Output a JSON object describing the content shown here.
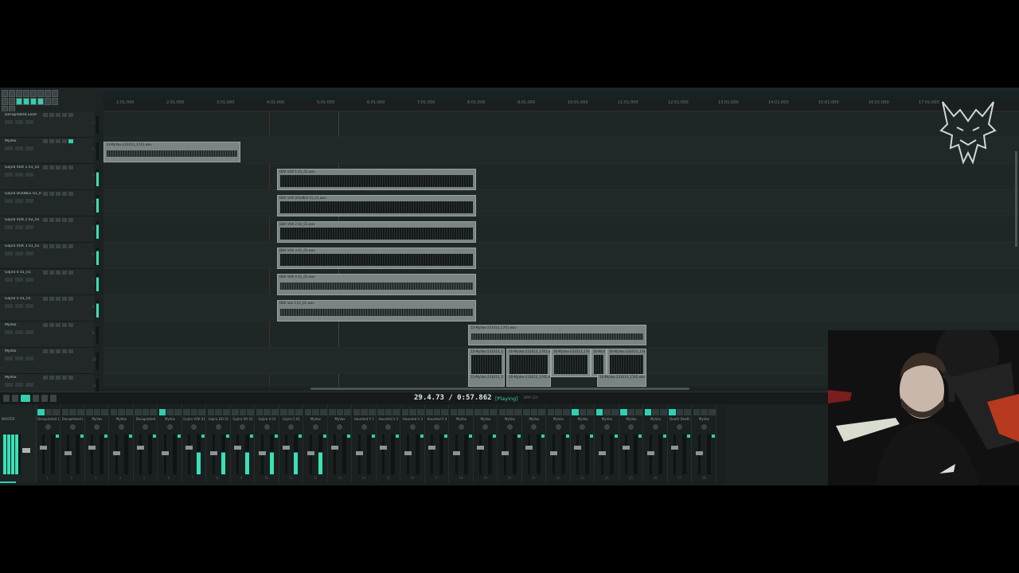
{
  "ruler": {
    "ticks": [
      "1:01:000",
      "2:01:000",
      "3:01:000",
      "4:01:000",
      "5:01:000",
      "6:01:000",
      "7:01:000",
      "8:01:000",
      "9:01:000",
      "10:01:000",
      "11:01:000",
      "12:01:000",
      "13:01:000",
      "14:01:000",
      "15:01:000",
      "16:01:000",
      "17:01:000"
    ]
  },
  "tracks": [
    {
      "name": "Decapitated Lead",
      "input": "Input 1",
      "num": "1"
    },
    {
      "name": "MyVox",
      "input": "Input 1",
      "num": "2"
    },
    {
      "name": "Gojira VOX 1 01_01",
      "input": "Input 1",
      "num": "3"
    },
    {
      "name": "Gojira DOUBLE 01_01",
      "input": "Input 1",
      "num": "4"
    },
    {
      "name": "Gojira VOX 2 02_01",
      "input": "Input 1",
      "num": "5"
    },
    {
      "name": "Gojira VOX 3 01_01",
      "input": "Input 1",
      "num": "6"
    },
    {
      "name": "Gojira 4 01_01",
      "input": "Input 1",
      "num": "7"
    },
    {
      "name": "Gojira 5 01_01",
      "input": "Input 1",
      "num": "8"
    },
    {
      "name": "MyVox",
      "input": "Input 1",
      "num": "9"
    },
    {
      "name": "MyVox",
      "input": "Input 1",
      "num": "10"
    },
    {
      "name": "MyVox",
      "input": "Input 1",
      "num": "11"
    }
  ],
  "clips": [
    {
      "name": "14-MyVox-231013_1741.wav"
    },
    {
      "name": "DBX VOX 1 01_01.wav"
    },
    {
      "name": "DBX VOX DOUBLE 01_01.wav"
    },
    {
      "name": "DBX VOX 2 02_01.wav"
    },
    {
      "name": "DBX VOX 3 01_01.wav"
    },
    {
      "name": "DBX VOX 4 01_01.wav"
    },
    {
      "name": "DBX Vox 5 01_01.wav"
    },
    {
      "name": "15-MyVox-231013_1741.wav"
    },
    {
      "name": "15-MyVox-231013_17"
    },
    {
      "name": "16-MyVox-231013_1741.wav"
    },
    {
      "name": "16-MyVox-231013_1741"
    },
    {
      "name": "16-MyV"
    },
    {
      "name": "16-MyVox-231013_1741"
    },
    {
      "name": "15-MyVox-231013_17"
    },
    {
      "name": "16-MyVox-231013_1745.wav"
    },
    {
      "name": "16-MyVox-231013_1745.wav"
    }
  ],
  "transport": {
    "time": "29.4.73 / 0:57.862",
    "status": "[Playing]",
    "bpm": "BPM 120",
    "sig": "4/4"
  },
  "mixer": {
    "master": "MASTER",
    "strips": [
      {
        "name": "Decapitated L",
        "num": "1"
      },
      {
        "name": "Decapitated L",
        "num": "2"
      },
      {
        "name": "MyVox",
        "num": "3"
      },
      {
        "name": "MyVox",
        "num": "4"
      },
      {
        "name": "Decapitated",
        "num": "5"
      },
      {
        "name": "MyVox",
        "num": "6"
      },
      {
        "name": "Gojira VOX 01",
        "num": "7"
      },
      {
        "name": "Gojira DO 01",
        "num": "8"
      },
      {
        "name": "Gojira VO 01",
        "num": "9"
      },
      {
        "name": "Gojira 4 01",
        "num": "10"
      },
      {
        "name": "Gojira 5 01",
        "num": "11"
      },
      {
        "name": "MyVox",
        "num": "12"
      },
      {
        "name": "MyVox",
        "num": "13"
      },
      {
        "name": "Haunted V 1",
        "num": "14"
      },
      {
        "name": "Haunted V 2",
        "num": "15"
      },
      {
        "name": "Haunted V 3",
        "num": "16"
      },
      {
        "name": "Haunted V 4",
        "num": "17"
      },
      {
        "name": "MyVox",
        "num": "18"
      },
      {
        "name": "MyVox",
        "num": "19"
      },
      {
        "name": "MyVox",
        "num": "20"
      },
      {
        "name": "MyVox",
        "num": "21"
      },
      {
        "name": "MyVox",
        "num": "22"
      },
      {
        "name": "MyVox",
        "num": "23"
      },
      {
        "name": "MyVox",
        "num": "24"
      },
      {
        "name": "MyVox",
        "num": "25"
      },
      {
        "name": "MyVox",
        "num": "26"
      },
      {
        "name": "Death Death",
        "num": "27"
      },
      {
        "name": "MyVox",
        "num": "28"
      }
    ]
  },
  "colors": {
    "accent": "#2fd0b0",
    "background": "#1c2121"
  }
}
